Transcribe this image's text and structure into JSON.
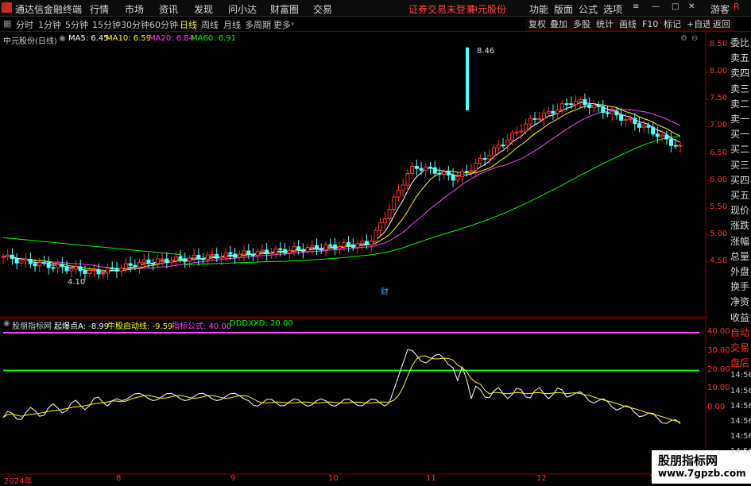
{
  "window": {
    "app_title": "通达信金融终端",
    "menu": [
      "行情",
      "市场",
      "资讯",
      "发现",
      "问小达",
      "财富圈",
      "交易"
    ],
    "login_status": "证券交易未登录",
    "stock_name": "中元股份",
    "right_menu": [
      "功能",
      "版面",
      "公式",
      "选项"
    ],
    "user": "游客"
  },
  "toolbar": {
    "periods": [
      "分时",
      "1分钟",
      "5分钟",
      "15分钟",
      "30分钟",
      "60分钟",
      "日线",
      "周线",
      "月线",
      "多周期",
      "更多"
    ],
    "active_period": "日线",
    "right_buttons": [
      "复权",
      "叠加",
      "多股",
      "统计",
      "画线",
      "F10",
      "标记",
      "+自选",
      "返回"
    ],
    "r_label": "R"
  },
  "main_chart": {
    "title": "中元股份(日线)",
    "ma_legend": [
      {
        "label": "MA5: 6.45",
        "color": "#ffffff"
      },
      {
        "label": "MA10: 6.59",
        "color": "#ffff00"
      },
      {
        "label": "MA20: 6.84",
        "color": "#ff40ff"
      },
      {
        "label": "MA60: 6.91",
        "color": "#00ff00"
      }
    ],
    "price_axis": [
      "8.50",
      "8.00",
      "7.50",
      "7.00",
      "6.50",
      "6.00",
      "5.50",
      "5.00",
      "4.50"
    ],
    "high_label": "8.46",
    "low_label": "4.10",
    "event_marker": "财"
  },
  "indicator_chart": {
    "title": "股朋指标网",
    "legend": [
      {
        "label": "起爆点A: -8.99",
        "color": "#ffffff"
      },
      {
        "label": "牛股启动线: -9.59",
        "color": "#ffff00"
      },
      {
        "label": "指标公式: 40.00",
        "color": "#ff40ff"
      },
      {
        "label": "DDDXXD: 20.00",
        "color": "#00ff00"
      }
    ],
    "axis": [
      "40.00",
      "30.00",
      "20.00",
      "10.00",
      "0.00"
    ]
  },
  "date_axis": [
    "2024年",
    "8",
    "9",
    "10",
    "11",
    "12",
    "1"
  ],
  "right_panel": [
    "委比",
    "卖五",
    "卖四",
    "卖三",
    "卖二",
    "卖一",
    "买一",
    "买二",
    "买三",
    "买四",
    "买五",
    "现价",
    "涨跌",
    "涨幅",
    "总量",
    "外盘",
    "换手",
    "净资",
    "收益",
    "自动",
    "交易",
    "盘后",
    "14:56",
    "14:56",
    "14:56",
    "14:56",
    "14:56",
    "14:56"
  ],
  "watermark": {
    "line1": "股朋指标网",
    "line2": "www.7gpzb.com"
  }
}
